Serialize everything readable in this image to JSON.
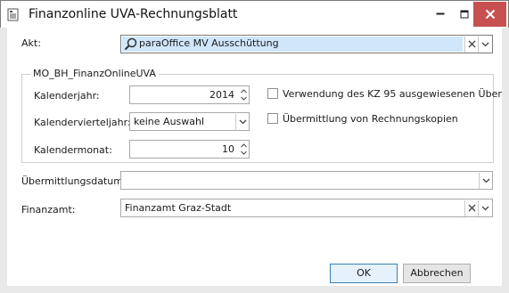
{
  "window": {
    "title": "Finanzonline UVA-Rechnungsblatt",
    "icon": "document-icon",
    "close_color": "#c75050"
  },
  "akt": {
    "label": "Akt:",
    "value": "paraOffice MV Ausschüttung",
    "highlight_color": "#cfe6fb"
  },
  "group": {
    "title": "MO_BH_FinanzOnlineUVA",
    "kalenderjahr": {
      "label": "Kalenderjahr:",
      "value": "2014"
    },
    "kalendervierteljahr": {
      "label": "Kalendervierteljahr:",
      "value": "keine Auswahl"
    },
    "kalendermonat": {
      "label": "Kalendermonat:",
      "value": "10"
    },
    "checkbox_kz95": {
      "label": "Verwendung des KZ 95 ausgewiesenen Über",
      "checked": false
    },
    "checkbox_kopien": {
      "label": "Übermittlung von Rechnungskopien",
      "checked": false
    }
  },
  "uebermittlungsdatum": {
    "label": "Übermittlungsdatum:",
    "value": ""
  },
  "finanzamt": {
    "label": "Finanzamt:",
    "value": "Finanzamt Graz-Stadt"
  },
  "buttons": {
    "ok": "OK",
    "cancel": "Abbrechen"
  }
}
